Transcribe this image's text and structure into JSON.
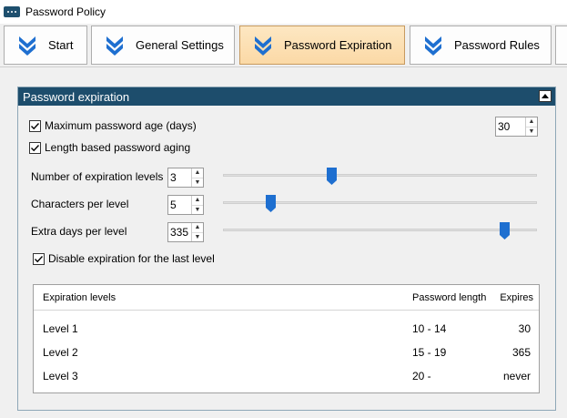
{
  "window": {
    "title": "Password Policy"
  },
  "tabs": [
    {
      "label": "Start",
      "active": false
    },
    {
      "label": "General Settings",
      "active": false
    },
    {
      "label": "Password Expiration",
      "active": true
    },
    {
      "label": "Password Rules",
      "active": false
    }
  ],
  "panel": {
    "title": "Password expiration",
    "max_age": {
      "label": "Maximum password age (days)",
      "checked": true,
      "value": "30"
    },
    "length_aging": {
      "label": "Length based password aging",
      "checked": true
    },
    "levels": {
      "label": "Number of expiration levels",
      "value": "3",
      "slider_fraction": 0.34
    },
    "chars": {
      "label": "Characters per level",
      "value": "5",
      "slider_fraction": 0.14
    },
    "extra_days": {
      "label": "Extra days per level",
      "value": "335",
      "slider_fraction": 0.91
    },
    "disable_last": {
      "label": "Disable expiration for the last level",
      "checked": true
    }
  },
  "table": {
    "headers": {
      "levels": "Expiration levels",
      "length": "Password length",
      "expires": "Expires"
    },
    "rows": [
      {
        "level": "Level 1",
        "length": "10 - 14",
        "expires": "30"
      },
      {
        "level": "Level 2",
        "length": "15 - 19",
        "expires": "365"
      },
      {
        "level": "Level 3",
        "length": "20 -",
        "expires": "never"
      }
    ]
  },
  "colors": {
    "header_bg": "#1d4d6c",
    "active_tab": "#fbd9a6",
    "accent": "#1e6fd0"
  }
}
